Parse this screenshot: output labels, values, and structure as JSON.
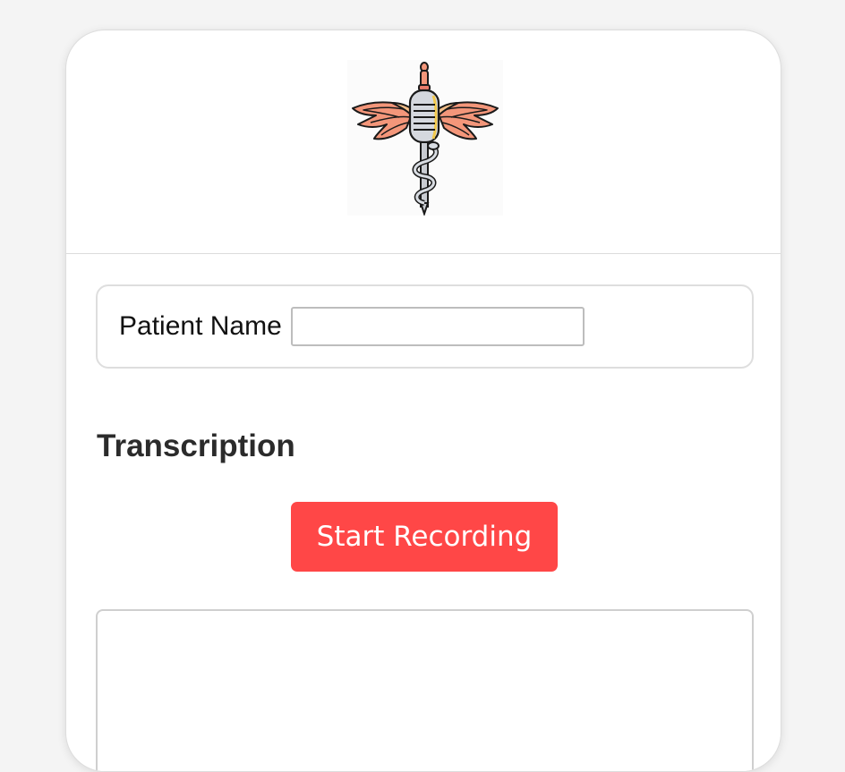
{
  "logo": {
    "name": "caduceus-microphone-logo"
  },
  "patient": {
    "label": "Patient Name",
    "value": "",
    "placeholder": ""
  },
  "transcription": {
    "title": "Transcription",
    "button_label": "Start Recording",
    "text": ""
  },
  "colors": {
    "background": "#f4f4f4",
    "card": "#ffffff",
    "record_button": "#ff4747"
  }
}
